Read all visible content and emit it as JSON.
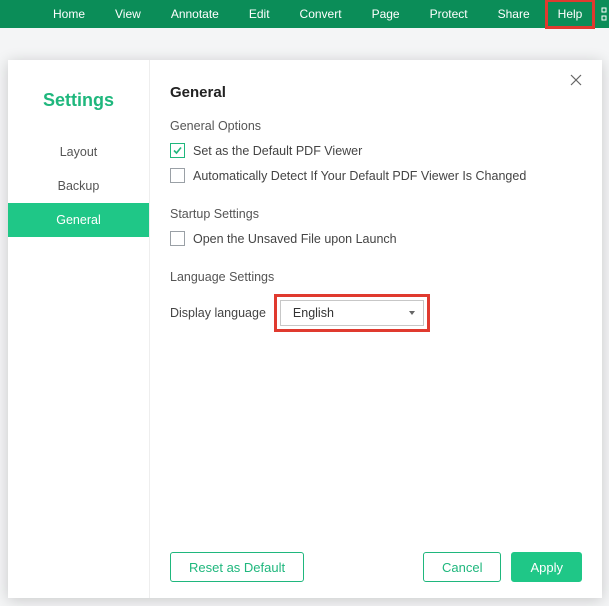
{
  "menubar": {
    "items": [
      {
        "label": "Home"
      },
      {
        "label": "View"
      },
      {
        "label": "Annotate"
      },
      {
        "label": "Edit"
      },
      {
        "label": "Convert"
      },
      {
        "label": "Page"
      },
      {
        "label": "Protect"
      },
      {
        "label": "Share"
      },
      {
        "label": "Help"
      }
    ]
  },
  "sidebar": {
    "title": "Settings",
    "items": [
      {
        "label": "Layout"
      },
      {
        "label": "Backup"
      },
      {
        "label": "General"
      }
    ]
  },
  "main": {
    "title": "General",
    "general_options_label": "General Options",
    "opt_default_viewer": "Set as the Default PDF Viewer",
    "opt_auto_detect": "Automatically Detect If Your Default PDF Viewer Is Changed",
    "startup_label": "Startup Settings",
    "opt_open_unsaved": "Open the Unsaved File upon Launch",
    "language_label": "Language Settings",
    "display_language_label": "Display language",
    "display_language_value": "English"
  },
  "footer": {
    "reset": "Reset as Default",
    "cancel": "Cancel",
    "apply": "Apply"
  }
}
